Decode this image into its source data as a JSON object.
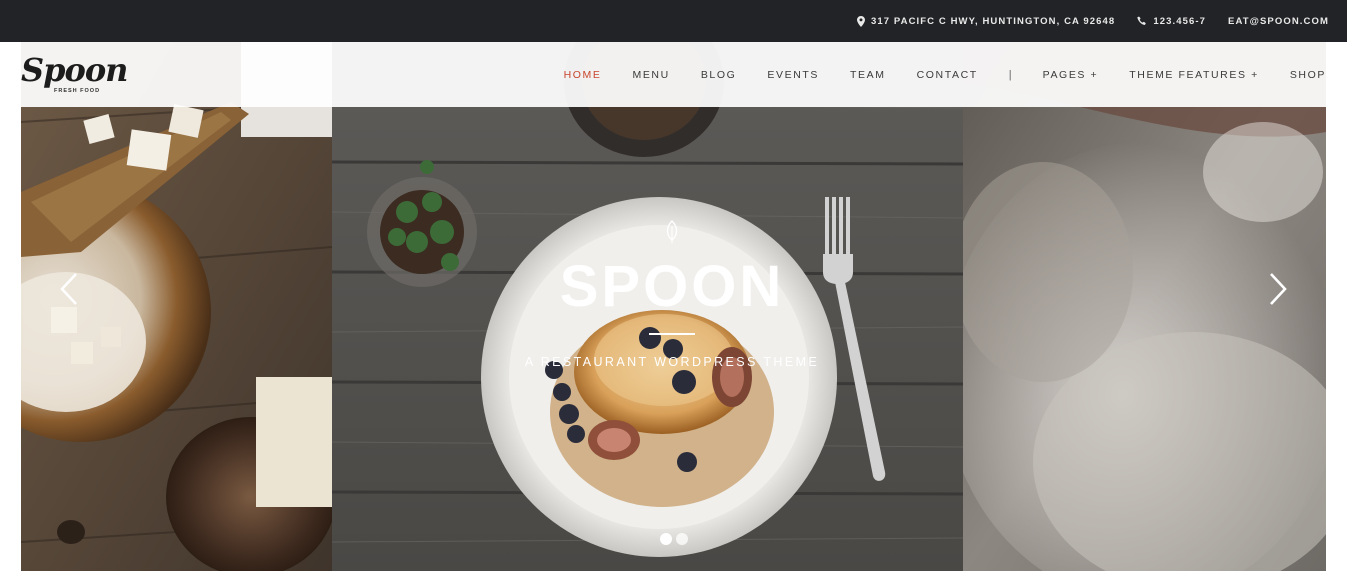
{
  "topbar": {
    "address": "317 PACIFC C HWY, HUNTINGTON, CA 92648",
    "phone": "123.456-7",
    "email": "EAT@SPOON.COM",
    "address_icon": "map-pin-icon",
    "phone_icon": "phone-icon"
  },
  "logo": {
    "word": "Spoon",
    "tagline": "FRESH FOOD"
  },
  "nav": {
    "items": [
      {
        "label": "HOME",
        "active": true
      },
      {
        "label": "MENU"
      },
      {
        "label": "BLOG"
      },
      {
        "label": "EVENTS"
      },
      {
        "label": "TEAM"
      },
      {
        "label": "CONTACT"
      },
      {
        "label": "|"
      },
      {
        "label": "PAGES +"
      },
      {
        "label": "THEME FEATURES +"
      },
      {
        "label": "SHOP"
      }
    ]
  },
  "hero": {
    "title": "SPOON",
    "subtitle": "A RESTAURANT WORDPRESS THEME",
    "icon": "leaf-icon"
  },
  "slider": {
    "prev_icon": "chevron-left-icon",
    "next_icon": "chevron-right-icon",
    "slide_count": 2,
    "active_slide": 1
  },
  "colors": {
    "topbar_bg": "#222326",
    "nav_active": "#c8452c",
    "nav_text": "#3a3a3a"
  }
}
